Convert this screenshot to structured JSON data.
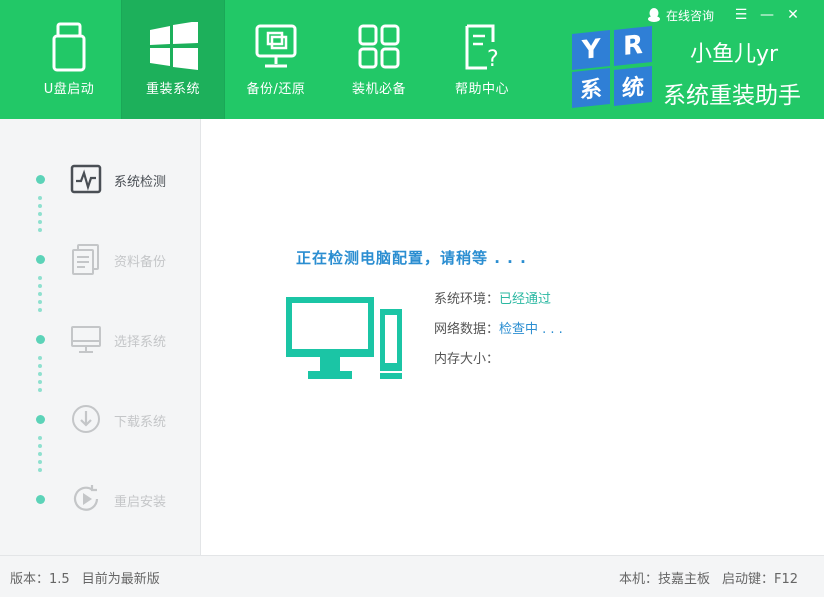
{
  "header": {
    "nav": [
      {
        "label": "U盘启动",
        "icon": "usb-drive-icon"
      },
      {
        "label": "重装系统",
        "icon": "windows-logo-icon"
      },
      {
        "label": "备份/还原",
        "icon": "backup-restore-icon"
      },
      {
        "label": "装机必备",
        "icon": "apps-grid-icon"
      },
      {
        "label": "帮助中心",
        "icon": "help-document-icon"
      }
    ],
    "active_nav": "重装系统",
    "consult_label": "在线咨询",
    "brand": {
      "tiles": [
        "Y",
        "R",
        "系",
        "统"
      ],
      "name_line1": "小鱼儿yr",
      "name_line2": "系统重装助手"
    }
  },
  "sidebar": {
    "steps": [
      {
        "label": "系统检测",
        "icon": "monitor-pulse-icon",
        "active": true
      },
      {
        "label": "资料备份",
        "icon": "documents-icon",
        "active": false
      },
      {
        "label": "选择系统",
        "icon": "desktop-icon",
        "active": false
      },
      {
        "label": "下载系统",
        "icon": "download-circle-icon",
        "active": false
      },
      {
        "label": "重启安装",
        "icon": "restart-icon",
        "active": false
      }
    ]
  },
  "main": {
    "status_title": "正在检测电脑配置，请稍等 . . .",
    "rows": [
      {
        "label": "系统环境：",
        "value": "已经通过"
      },
      {
        "label": "网络数据：",
        "value": "检查中 . . ."
      },
      {
        "label": "内存大小：",
        "value": ""
      }
    ]
  },
  "footer": {
    "version_label": "版本：1.5",
    "latest_text": "目前为最新版",
    "machine_label": "本机：技嘉主板",
    "hotkey_label": "启动键：F12"
  },
  "colors": {
    "header_green": "#22c867",
    "accent_teal": "#1bc5a5",
    "accent_blue": "#2b8ed1",
    "tile_blue": "#2f7fd6"
  }
}
